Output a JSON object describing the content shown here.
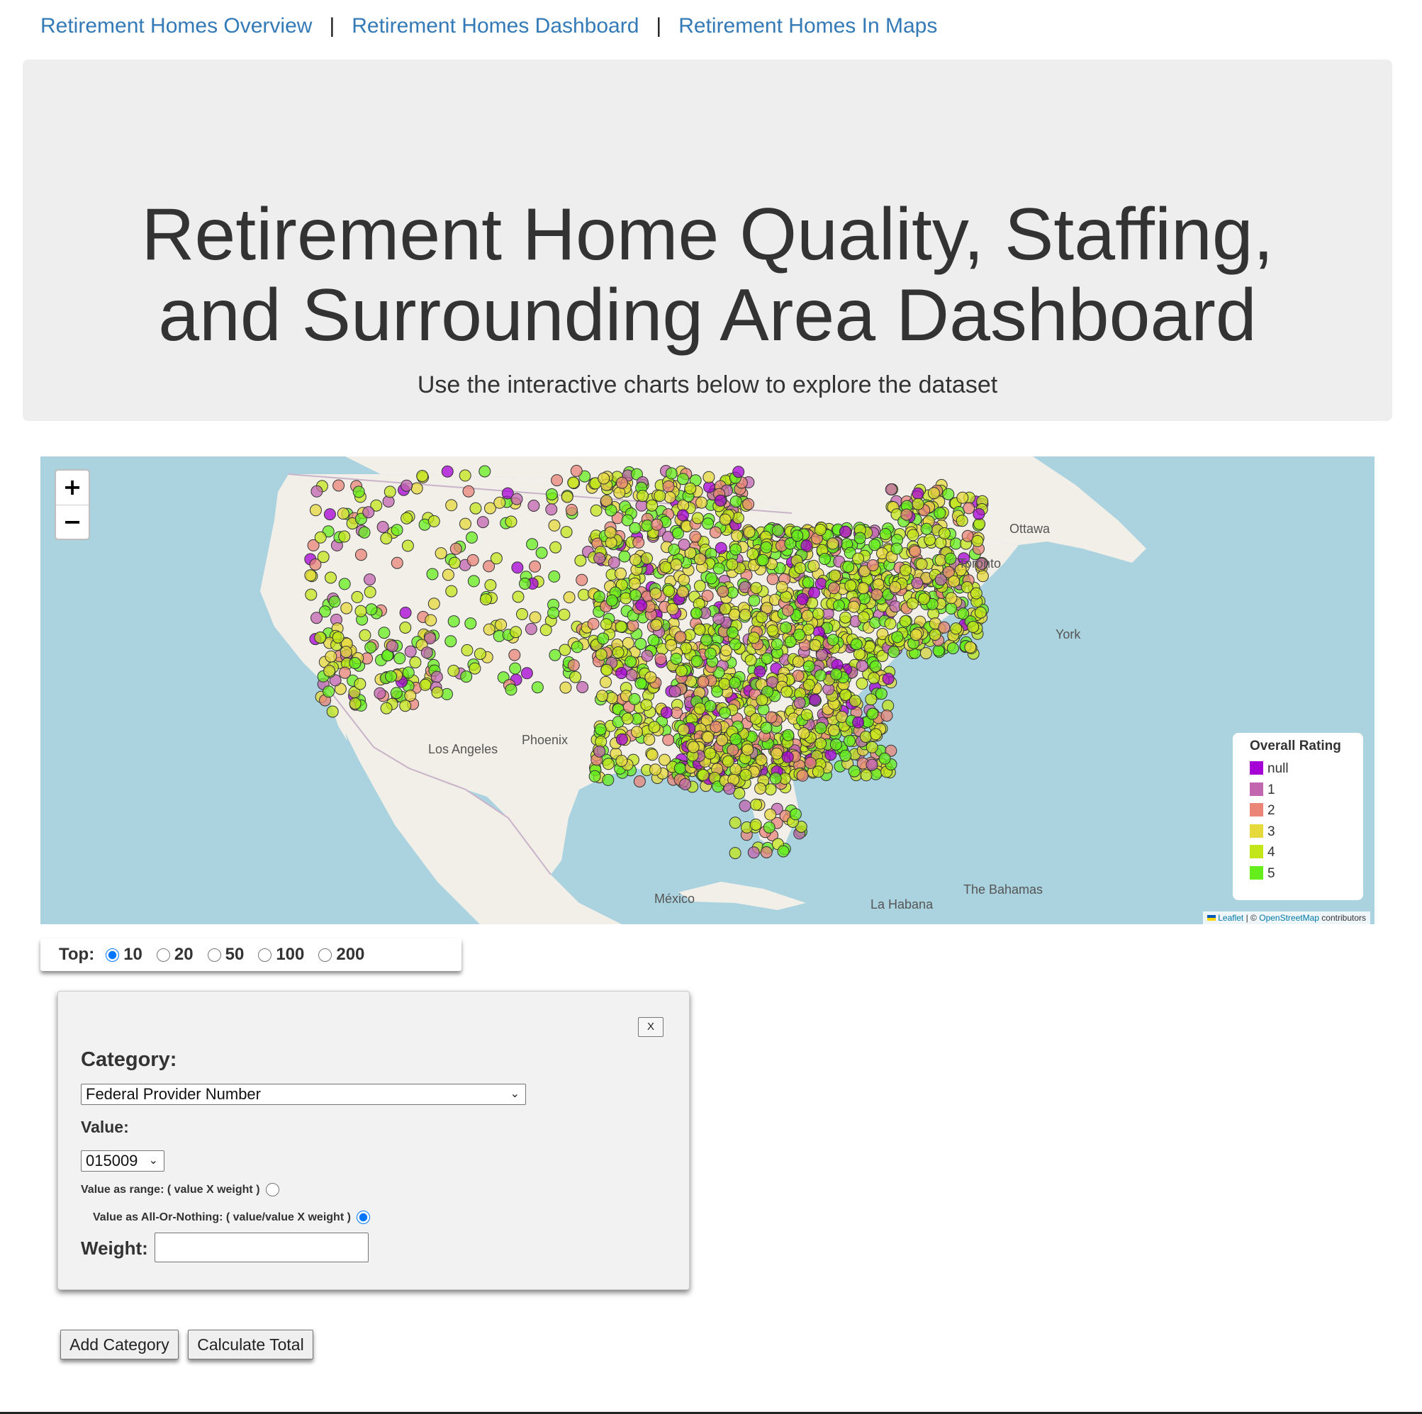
{
  "nav": {
    "links": [
      "Retirement Homes Overview",
      "Retirement Homes Dashboard",
      "Retirement Homes In Maps"
    ],
    "separator": "|"
  },
  "header": {
    "title_line1": "Retirement Home Quality, Staffing,",
    "title_line2": "and Surrounding Area Dashboard",
    "subtitle": "Use the interactive charts below to explore the dataset"
  },
  "map": {
    "zoom_in": "+",
    "zoom_out": "−",
    "cities": [
      "Ottawa",
      "Toronto",
      "York",
      "Los Angeles",
      "Phoenix",
      "México",
      "La Habana",
      "The Bahamas"
    ],
    "legend": {
      "title": "Overall Rating",
      "items": [
        {
          "label": "null",
          "color": "#a500d6"
        },
        {
          "label": "1",
          "color": "#c266b0"
        },
        {
          "label": "2",
          "color": "#ea8578"
        },
        {
          "label": "3",
          "color": "#e6d93c"
        },
        {
          "label": "4",
          "color": "#c2e61a"
        },
        {
          "label": "5",
          "color": "#66ee1c"
        }
      ]
    },
    "attribution": {
      "leaflet": "Leaflet",
      "sep": "| ©",
      "osm": "OpenStreetMap",
      "tail": "contributors"
    },
    "colors": {
      "water": "#aad3df",
      "land": "#f2efe9",
      "border": "#c9b3c9"
    }
  },
  "top": {
    "label": "Top:",
    "options": [
      "10",
      "20",
      "50",
      "100",
      "200"
    ],
    "selected": "10"
  },
  "panel": {
    "close": "X",
    "category_label": "Category:",
    "category_value": "Federal Provider Number",
    "value_label": "Value:",
    "value_value": "015009",
    "range_label": "Value as range: ( value X weight )",
    "aon_label": "Value as All-Or-Nothing: ( value/value X weight )",
    "weight_label": "Weight:",
    "weight_value": ""
  },
  "buttons": {
    "add": "Add Category",
    "calc": "Calculate Total"
  }
}
